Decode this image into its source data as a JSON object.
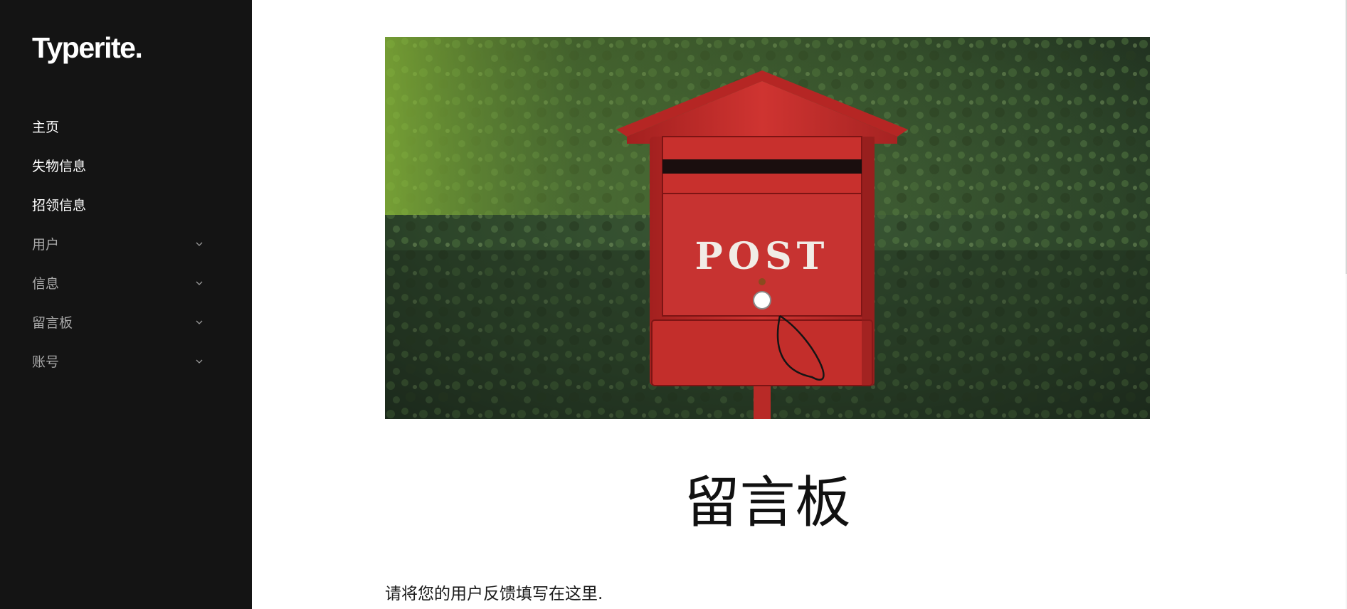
{
  "sidebar": {
    "logo": "Typerite.",
    "items": [
      {
        "label": "主页",
        "style": "primary",
        "has_submenu": false
      },
      {
        "label": "失物信息",
        "style": "primary",
        "has_submenu": false
      },
      {
        "label": "招领信息",
        "style": "primary",
        "has_submenu": false
      },
      {
        "label": "用户",
        "style": "secondary",
        "has_submenu": true
      },
      {
        "label": "信息",
        "style": "secondary",
        "has_submenu": true
      },
      {
        "label": "留言板",
        "style": "secondary",
        "has_submenu": true
      },
      {
        "label": "账号",
        "style": "secondary",
        "has_submenu": true
      }
    ]
  },
  "main": {
    "hero": {
      "mailbox_text": "POST"
    },
    "title": "留言板",
    "description": "请将您的用户反馈填写在这里."
  },
  "colors": {
    "sidebar_bg": "#141414",
    "accent_red": "#c62f2f",
    "foliage": "#2f4a2c"
  }
}
